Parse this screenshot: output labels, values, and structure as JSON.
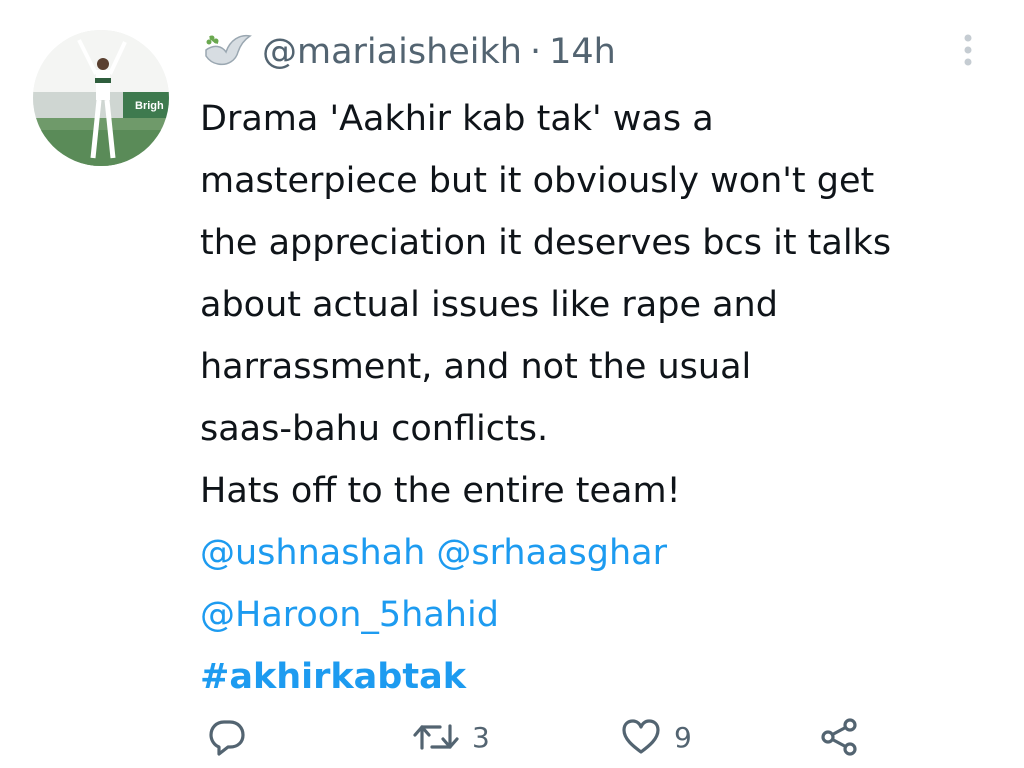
{
  "tweet": {
    "handle": "@mariaisheikh",
    "separator": "·",
    "time": "14h",
    "avatar_text": "Brigh",
    "lines": [
      "Drama 'Aakhir kab tak' was a",
      "masterpiece but it obviously won't get",
      "the appreciation it deserves bcs it talks",
      "about actual issues like rape and",
      "harrassment, and not the usual",
      "saas-bahu conflicts.",
      "Hats off to the entire team!"
    ],
    "mentions_line1": [
      "@ushnashah",
      "@srhaasghar"
    ],
    "mentions_line2": [
      "@Haroon_5hahid"
    ],
    "hashtag": "#akhirkabtak"
  },
  "actions": {
    "reply": {
      "icon": "reply-icon"
    },
    "retweet": {
      "icon": "retweet-icon",
      "count": "3"
    },
    "like": {
      "icon": "heart-icon",
      "count": "9"
    },
    "share": {
      "icon": "share-icon"
    }
  },
  "colors": {
    "text": "#0f1419",
    "secondary": "#536471",
    "link": "#1d9bf0"
  }
}
